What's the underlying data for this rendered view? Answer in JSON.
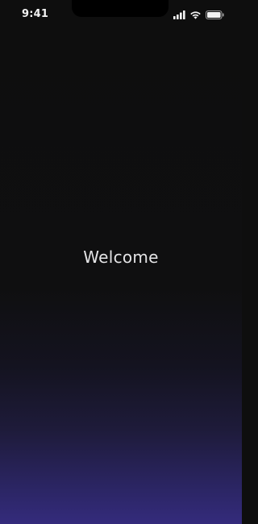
{
  "status_bar": {
    "time": "9:41",
    "icons": [
      "cellular-signal-icon",
      "wifi-icon",
      "battery-icon"
    ]
  },
  "main": {
    "welcome_text": "Welcome"
  },
  "colors": {
    "background_top": "#0e0e0e",
    "background_bottom": "#342b7c",
    "text": "#e4e4e6"
  }
}
